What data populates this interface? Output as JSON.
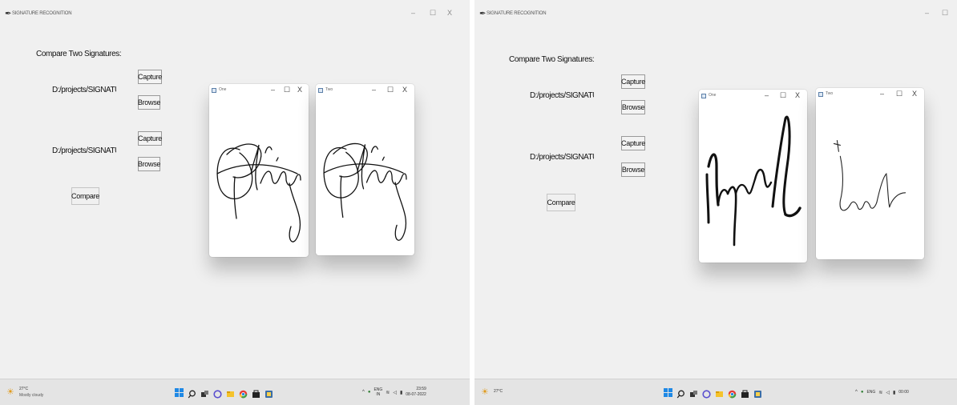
{
  "screens": [
    {
      "window_title": "SIGNATURE RECOGNITION",
      "controls": [
        "–",
        "☐",
        "X"
      ],
      "compare_label": "Compare Two Signatures:",
      "path1": "D:/projects/SIGNATURE-F",
      "path2": "D:/projects/SIGNATURE-F",
      "capture_label": "Capture",
      "browse_label": "Browse",
      "compare_button": "Compare",
      "child_windows": [
        {
          "name": "One",
          "controls": [
            "–",
            "☐",
            "X"
          ]
        },
        {
          "name": "Two",
          "controls": [
            "–",
            "☐",
            "X"
          ]
        }
      ],
      "taskbar": {
        "temperature": "27°C",
        "weather": "Mostly cloudy",
        "lang_top": "ENG",
        "lang_bottom": "IN",
        "time": "23:59",
        "date": "08-07-2022"
      }
    },
    {
      "window_title": "SIGNATURE RECOGNITION",
      "controls": [
        "–",
        "☐"
      ],
      "compare_label": "Compare Two Signatures:",
      "path1": "D:/projects/SIGNATURE-F",
      "path2": "D:/projects/SIGNATURE-F",
      "capture_label": "Capture",
      "browse_label": "Browse",
      "compare_button": "Compare",
      "child_windows": [
        {
          "name": "One",
          "controls": [
            "–",
            "☐",
            "X"
          ]
        },
        {
          "name": "Two",
          "controls": [
            "–",
            "☐",
            "X"
          ]
        }
      ],
      "taskbar": {
        "temperature": "27°C",
        "lang_top": "ENG",
        "time": "00:00"
      }
    }
  ],
  "colors": {
    "window_bg": "#f0f0f0",
    "taskbar_bg": "#e4e4e4",
    "windows_logo": "#1e88e5",
    "weather_icon": "#e09a1a"
  },
  "icons": {
    "app": "feather-icon",
    "taskbar": [
      "windows-start-icon",
      "search-icon",
      "task-view-icon",
      "chat-icon",
      "file-explorer-icon",
      "chrome-icon",
      "store-icon",
      "python-icon"
    ],
    "tray": [
      "chevron-up-icon",
      "wifi-icon",
      "volume-icon",
      "battery-icon"
    ]
  }
}
